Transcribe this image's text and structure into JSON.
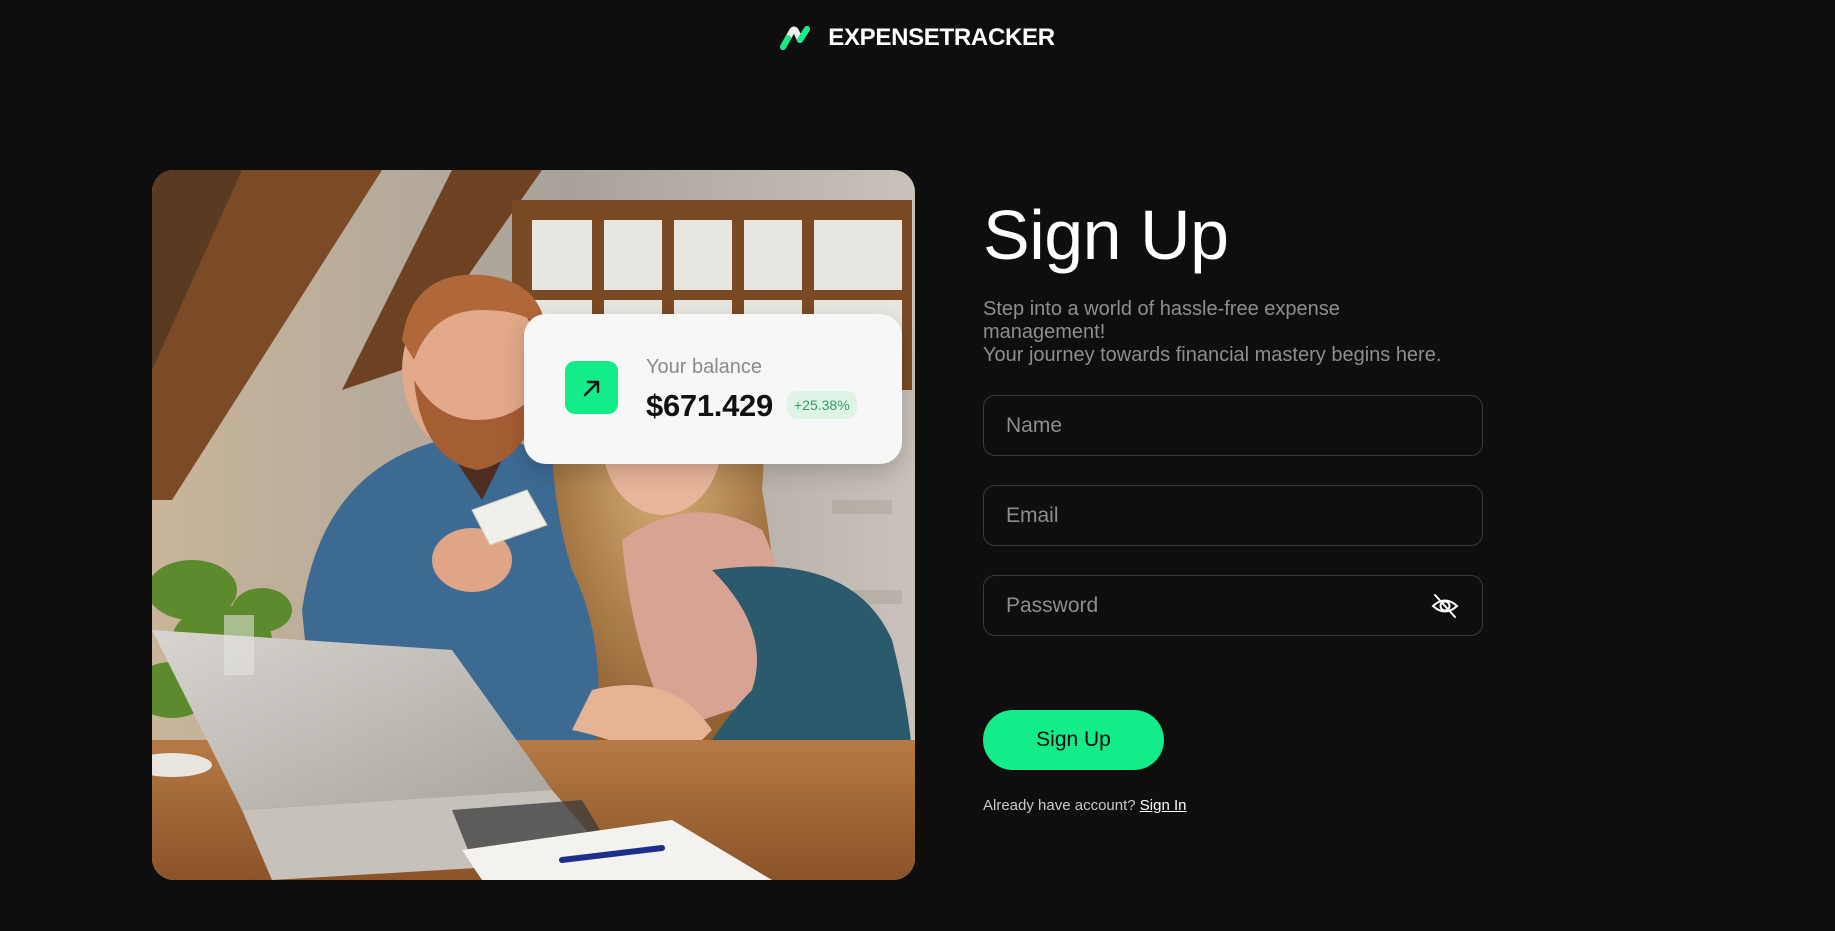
{
  "brand": {
    "name": "EXPENSETRACKER",
    "icon": "logo-mark-icon",
    "accent_color": "#14ec8a"
  },
  "hero": {
    "image": "couple-with-laptop-and-credit-card-photo"
  },
  "balance_card": {
    "label": "Your balance",
    "amount": "$671.429",
    "change": "+25.38%",
    "icon": "arrow-up-right-icon"
  },
  "signup": {
    "title": "Sign Up",
    "subtitle_line1": "Step into a world of hassle-free expense management!",
    "subtitle_line2": "Your journey towards financial mastery begins here.",
    "name_placeholder": "Name",
    "email_placeholder": "Email",
    "password_placeholder": "Password",
    "password_toggle_icon": "eye-off-icon",
    "submit_label": "Sign Up",
    "already_text": "Already have account?",
    "signin_link": "Sign In"
  },
  "colors": {
    "background": "#0e0e0e",
    "accent": "#14ec8a",
    "card": "#f7f7f7",
    "badge_bg": "#dff3e7",
    "badge_text": "#2fa063"
  }
}
